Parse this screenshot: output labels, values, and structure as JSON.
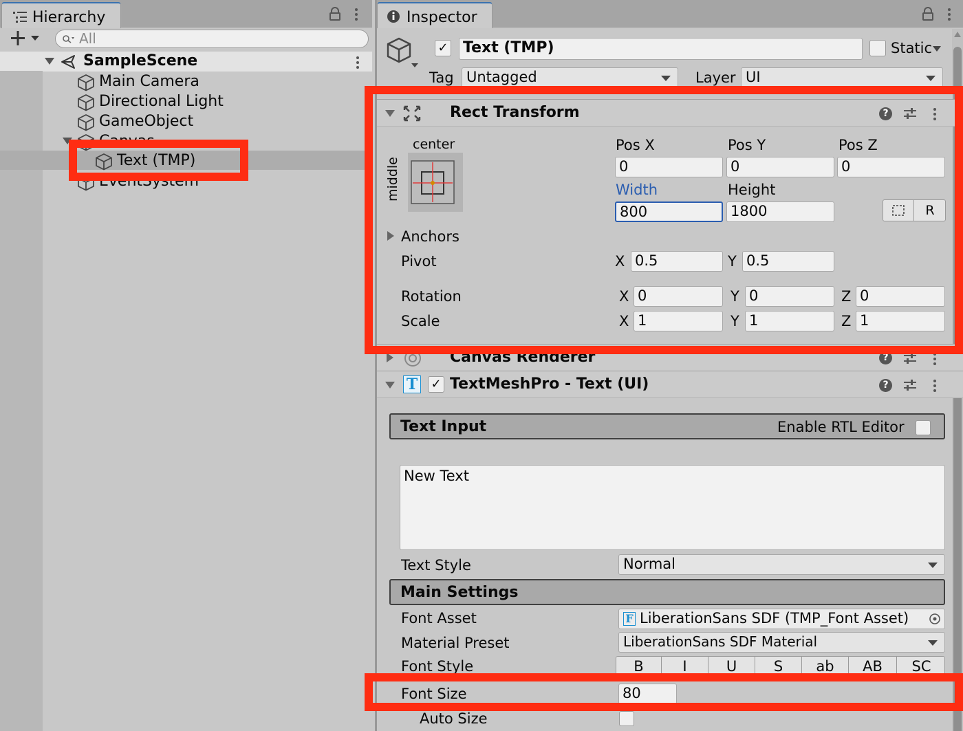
{
  "hierarchy": {
    "tab_label": "Hierarchy",
    "search_placeholder": "All",
    "scene_name": "SampleScene",
    "items": [
      {
        "label": "Main Camera"
      },
      {
        "label": "Directional Light"
      },
      {
        "label": "GameObject"
      },
      {
        "label": "Canvas"
      },
      {
        "label": "Text (TMP)"
      },
      {
        "label": "EventSystem"
      }
    ]
  },
  "inspector": {
    "tab_label": "Inspector",
    "object_name": "Text (TMP)",
    "active_checked": true,
    "static_label": "Static",
    "tag_label": "Tag",
    "tag_value": "Untagged",
    "layer_label": "Layer",
    "layer_value": "UI",
    "rect_transform": {
      "title": "Rect Transform",
      "anchor_h": "center",
      "anchor_v": "middle",
      "pos_x_label": "Pos X",
      "pos_x": "0",
      "pos_y_label": "Pos Y",
      "pos_y": "0",
      "pos_z_label": "Pos Z",
      "pos_z": "0",
      "width_label": "Width",
      "width": "800",
      "height_label": "Height",
      "height": "1800",
      "raw_button": "R",
      "anchors_label": "Anchors",
      "pivot_label": "Pivot",
      "pivot_x": "0.5",
      "pivot_y": "0.5",
      "rotation_label": "Rotation",
      "rot_x": "0",
      "rot_y": "0",
      "rot_z": "0",
      "scale_label": "Scale",
      "scale_x": "1",
      "scale_y": "1",
      "scale_z": "1",
      "x": "X",
      "y": "Y",
      "z": "Z"
    },
    "canvas_renderer": {
      "title": "Canvas Renderer"
    },
    "tmp": {
      "title": "TextMeshPro - Text (UI)",
      "text_input_label": "Text Input",
      "rtl_label": "Enable RTL Editor",
      "text_value": "New Text",
      "text_style_label": "Text Style",
      "text_style_value": "Normal",
      "main_settings_label": "Main Settings",
      "font_asset_label": "Font Asset",
      "font_asset_value": "LiberationSans SDF (TMP_Font Asset)",
      "material_preset_label": "Material Preset",
      "material_preset_value": "LiberationSans SDF Material",
      "font_style_label": "Font Style",
      "font_style_buttons": [
        "B",
        "I",
        "U",
        "S",
        "ab",
        "AB",
        "SC"
      ],
      "font_size_label": "Font Size",
      "font_size_value": "80",
      "auto_size_label": "Auto Size"
    }
  },
  "colors": {
    "highlight": "#ff2d12",
    "accent_blue": "#2a5db0",
    "panel_bg": "#c8c8c8"
  }
}
